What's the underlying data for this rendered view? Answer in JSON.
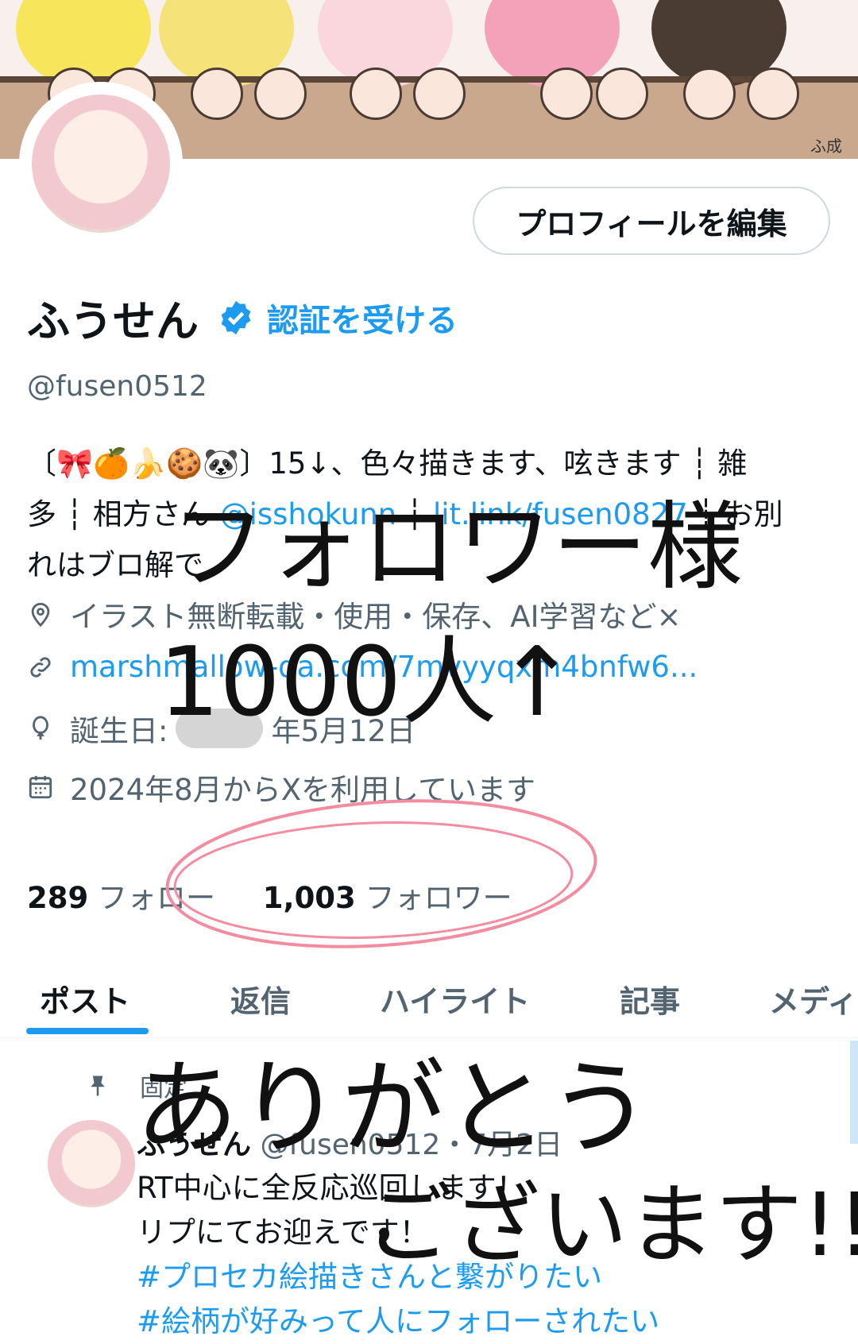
{
  "banner": {
    "signature": "ふ成"
  },
  "profile": {
    "edit_button": "プロフィールを編集",
    "name": "ふうせん",
    "get_verified": "認証を受ける",
    "handle": "@fusen0512",
    "bio_line1": "〔🎀🍊🍌🍪🐼〕15↓、色々描きます、呟きます ┆ 雑",
    "bio_line2_a": "多 ┆ 相方さん ",
    "bio_line2_mention": "@isshokunn",
    "bio_line2_sep": " ┆ ",
    "bio_line2_link": "lit.link/fusen0827",
    "bio_line2_b": " ┆ お別",
    "bio_line3": "れはブロ解で",
    "location": "イラスト無断転載・使用・保存、AI学習など×",
    "website": "marshmallow-qa.com/7mvyyqxm4bnfw6...",
    "birthday_prefix": "誕生日:",
    "birthday_suffix": "年5月12日",
    "joined": "2024年8月からXを利用しています",
    "following_count": "289",
    "following_label": "フォロー",
    "followers_count": "1,003",
    "followers_label": "フォロワー"
  },
  "tabs": [
    "ポスト",
    "返信",
    "ハイライト",
    "記事",
    "メディア"
  ],
  "pinned_tweet": {
    "pinned_label": "固定",
    "author": "ふうせん",
    "handle_date": "@fusen0512・7月2日",
    "line1": "RT中心に全反応巡回します！",
    "line2": "リプにてお迎えです！",
    "hashtag1": "#プロセカ絵描きさんと繋がりたい",
    "hashtag2": "#絵柄が好みって人にフォローされたい"
  },
  "handwriting": {
    "line1": "フォロワー様",
    "line2": "1000人↑",
    "line3": "ありがとう",
    "line4": "ございます!!"
  },
  "colors": {
    "accent": "#1d9bf0",
    "circle": "#f48ca0"
  }
}
